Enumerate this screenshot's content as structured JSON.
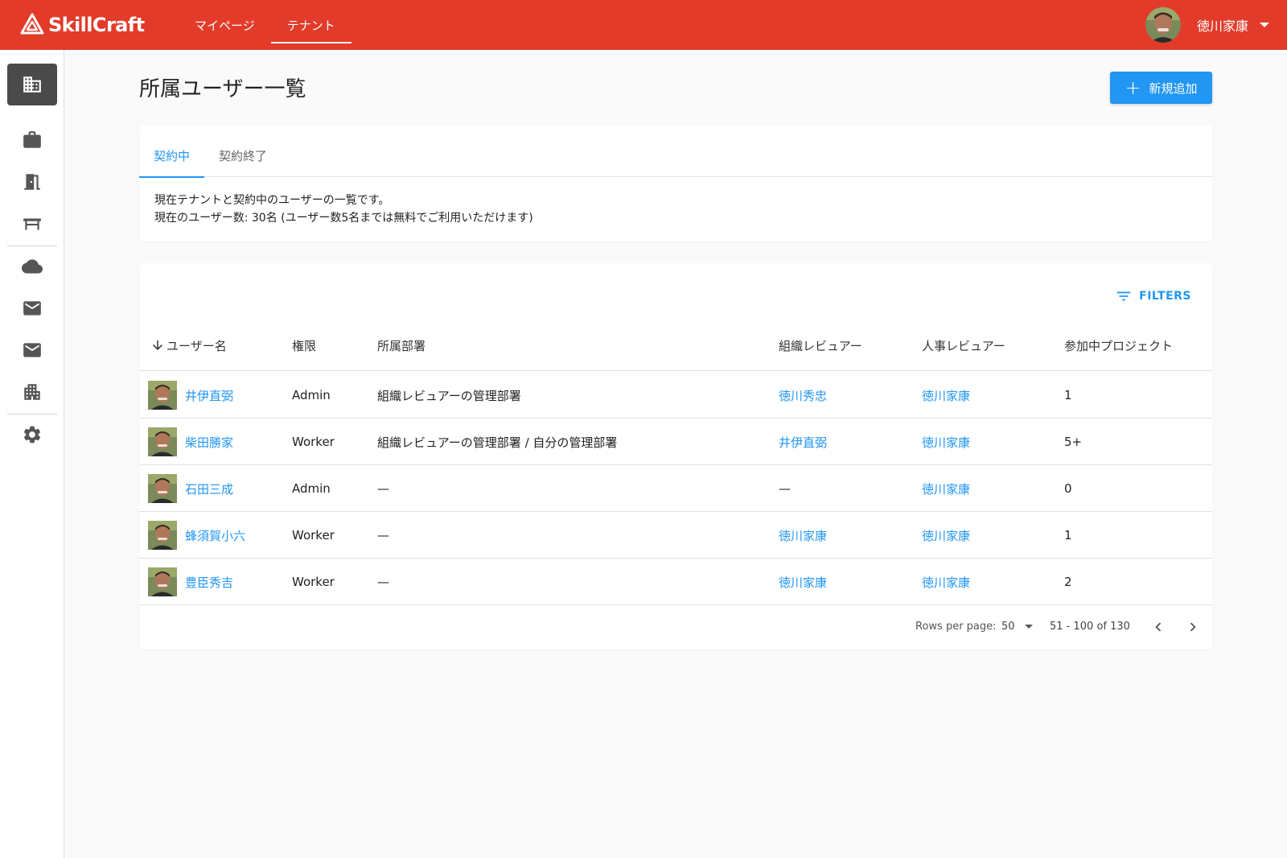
{
  "header": {
    "logo_text": "SkillCraft",
    "nav": [
      {
        "label": "マイページ",
        "active": false
      },
      {
        "label": "テナント",
        "active": true
      }
    ],
    "user_name": "徳川家康",
    "accent_color": "#e23b2a"
  },
  "sidebar": {
    "items": [
      {
        "icon": "domain-icon",
        "active": true
      },
      {
        "icon": "briefcase-icon"
      },
      {
        "icon": "door-icon"
      },
      {
        "icon": "desk-icon"
      },
      {
        "icon": "cloud-icon"
      },
      {
        "icon": "mail-icon"
      },
      {
        "icon": "mail-icon"
      },
      {
        "icon": "apartment-icon"
      },
      {
        "icon": "gear-icon"
      }
    ]
  },
  "page": {
    "title": "所属ユーザー一覧",
    "add_button_label": "新規追加",
    "tabs": [
      {
        "label": "契約中",
        "active": true
      },
      {
        "label": "契約終了",
        "active": false
      }
    ],
    "description_line1": "現在テナントと契約中のユーザーの一覧です。",
    "description_line2": "現在のユーザー数: 30名 (ユーザー数5名までは無料でご利用いただけます)"
  },
  "table": {
    "filters_label": "FILTERS",
    "sort_icon": "arrow-down-icon",
    "columns": [
      "ユーザー名",
      "権限",
      "所属部署",
      "組織レビュアー",
      "人事レビュアー",
      "参加中プロジェクト"
    ],
    "rows": [
      {
        "name": "井伊直弼",
        "role": "Admin",
        "dept": "組織レビュアーの管理部署",
        "org_reviewer": "徳川秀忠",
        "hr_reviewer": "徳川家康",
        "projects": "1"
      },
      {
        "name": "柴田勝家",
        "role": "Worker",
        "dept": "組織レビュアーの管理部署 / 自分の管理部署",
        "org_reviewer": "井伊直弼",
        "hr_reviewer": "徳川家康",
        "projects": "5+"
      },
      {
        "name": "石田三成",
        "role": "Admin",
        "dept": "—",
        "org_reviewer": "—",
        "hr_reviewer": "徳川家康",
        "projects": "0"
      },
      {
        "name": "蜂須賀小六",
        "role": "Worker",
        "dept": "—",
        "org_reviewer": "徳川家康",
        "hr_reviewer": "徳川家康",
        "projects": "1"
      },
      {
        "name": "豊臣秀吉",
        "role": "Worker",
        "dept": "—",
        "org_reviewer": "徳川家康",
        "hr_reviewer": "徳川家康",
        "projects": "2"
      }
    ],
    "pagination": {
      "rows_per_page_label": "Rows per page:",
      "rows_per_page": "50",
      "range": "51 - 100 of 130"
    }
  }
}
